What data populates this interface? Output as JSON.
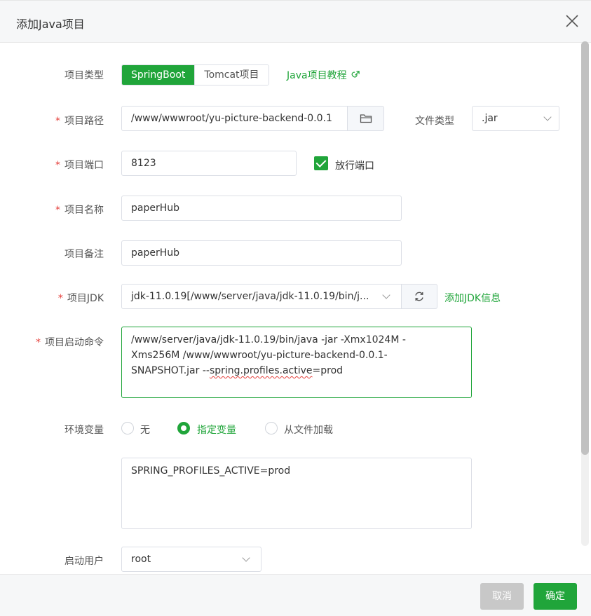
{
  "dialog": {
    "title": "添加Java项目"
  },
  "form": {
    "project_type": {
      "label": "项目类型",
      "options": [
        "SpringBoot",
        "Tomcat项目"
      ],
      "selected": "SpringBoot",
      "tutorial_link": "Java项目教程"
    },
    "project_path": {
      "label": "项目路径",
      "value": "/www/wwwroot/yu-picture-backend-0.0.1"
    },
    "file_type": {
      "label": "文件类型",
      "value": ".jar"
    },
    "project_port": {
      "label": "项目端口",
      "value": "8123",
      "allow_port_label": "放行端口",
      "allow_port_checked": true
    },
    "project_name": {
      "label": "项目名称",
      "value": "paperHub"
    },
    "project_remark": {
      "label": "项目备注",
      "value": "paperHub"
    },
    "project_jdk": {
      "label": "项目JDK",
      "value": "jdk-11.0.19[/www/server/java/jdk-11.0.19/bin/j...",
      "add_link": "添加JDK信息"
    },
    "start_command": {
      "label": "项目启动命令",
      "line1": "/www/server/java/jdk-11.0.19/bin/java -jar  -Xmx1024M -",
      "line2": "Xms256M /www/wwwroot/yu-picture-backend-0.0.1-",
      "line3_pre": "SNAPSHOT.jar --",
      "line3_mark": "spring.profiles.active",
      "line3_post": "=prod"
    },
    "env_vars": {
      "label": "环境变量",
      "options": [
        "无",
        "指定变量",
        "从文件加载"
      ],
      "selected": "指定变量",
      "value": "SPRING_PROFILES_ACTIVE=prod"
    },
    "run_user": {
      "label": "启动用户",
      "value": "root"
    },
    "required_mark": "*"
  },
  "footer": {
    "cancel_label": "取消",
    "ok_label": "确定"
  },
  "colors": {
    "accent": "#20a53a",
    "required": "#e5413d"
  }
}
